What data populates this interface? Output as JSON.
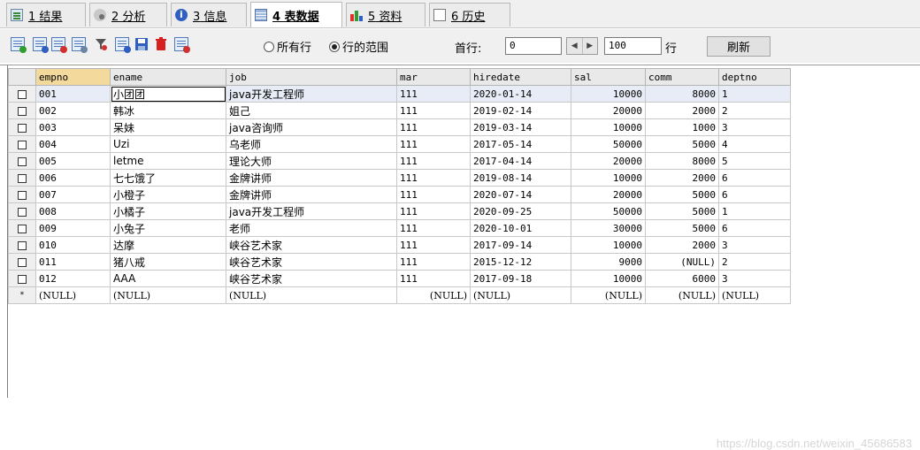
{
  "tabs": [
    {
      "num": "1",
      "label": "结果",
      "icon": "result-grid-icon"
    },
    {
      "num": "2",
      "label": "分析",
      "icon": "analyze-icon"
    },
    {
      "num": "3",
      "label": "信息",
      "icon": "info-icon"
    },
    {
      "num": "4",
      "label": "表数据",
      "icon": "table-icon",
      "active": true
    },
    {
      "num": "5",
      "label": "资料",
      "icon": "profile-chart-icon"
    },
    {
      "num": "6",
      "label": "历史",
      "icon": "history-calendar-icon"
    }
  ],
  "toolbar": {
    "radio_all": "所有行",
    "radio_range": "行的范围",
    "first_row_label": "首行:",
    "first_row_value": "0",
    "row_count_value": "100",
    "rows_label": "行",
    "refresh_label": "刷新"
  },
  "table": {
    "columns": [
      "empno",
      "ename",
      "job",
      "mar",
      "hiredate",
      "sal",
      "comm",
      "deptno"
    ],
    "rows": [
      [
        "001",
        "小团团",
        "java开发工程师",
        "111",
        "2020-01-14",
        "10000",
        "8000",
        "1"
      ],
      [
        "002",
        "韩冰",
        "姐己",
        "111",
        "2019-02-14",
        "20000",
        "2000",
        "2"
      ],
      [
        "003",
        "呆妹",
        "java咨询师",
        "111",
        "2019-03-14",
        "10000",
        "1000",
        "3"
      ],
      [
        "004",
        "Uzi",
        "乌老师",
        "111",
        "2017-05-14",
        "50000",
        "5000",
        "4"
      ],
      [
        "005",
        "letme",
        "理论大师",
        "111",
        "2017-04-14",
        "20000",
        "8000",
        "5"
      ],
      [
        "006",
        "七七饿了",
        "金牌讲师",
        "111",
        "2019-08-14",
        "10000",
        "2000",
        "6"
      ],
      [
        "007",
        "小橙子",
        "金牌讲师",
        "111",
        "2020-07-14",
        "20000",
        "5000",
        "6"
      ],
      [
        "008",
        "小橘子",
        "java开发工程师",
        "111",
        "2020-09-25",
        "50000",
        "5000",
        "1"
      ],
      [
        "009",
        "小兔子",
        "老师",
        "111",
        "2020-10-01",
        "30000",
        "5000",
        "6"
      ],
      [
        "010",
        "达摩",
        "峡谷艺术家",
        "111",
        "2017-09-14",
        "10000",
        "2000",
        "3"
      ],
      [
        "011",
        "猪八戒",
        "峡谷艺术家",
        "111",
        "2015-12-12",
        "9000",
        "(NULL)",
        "2"
      ],
      [
        "012",
        "AAA",
        "峡谷艺术家",
        "111",
        "2017-09-18",
        "10000",
        "6000",
        "3"
      ]
    ],
    "new_row": [
      "(NULL)",
      "(NULL)",
      "(NULL)",
      "(NULL)",
      "(NULL)",
      "(NULL)",
      "(NULL)",
      "(NULL)"
    ],
    "new_row_marker": "*"
  },
  "watermark": "https://blog.csdn.net/weixin_45686583"
}
